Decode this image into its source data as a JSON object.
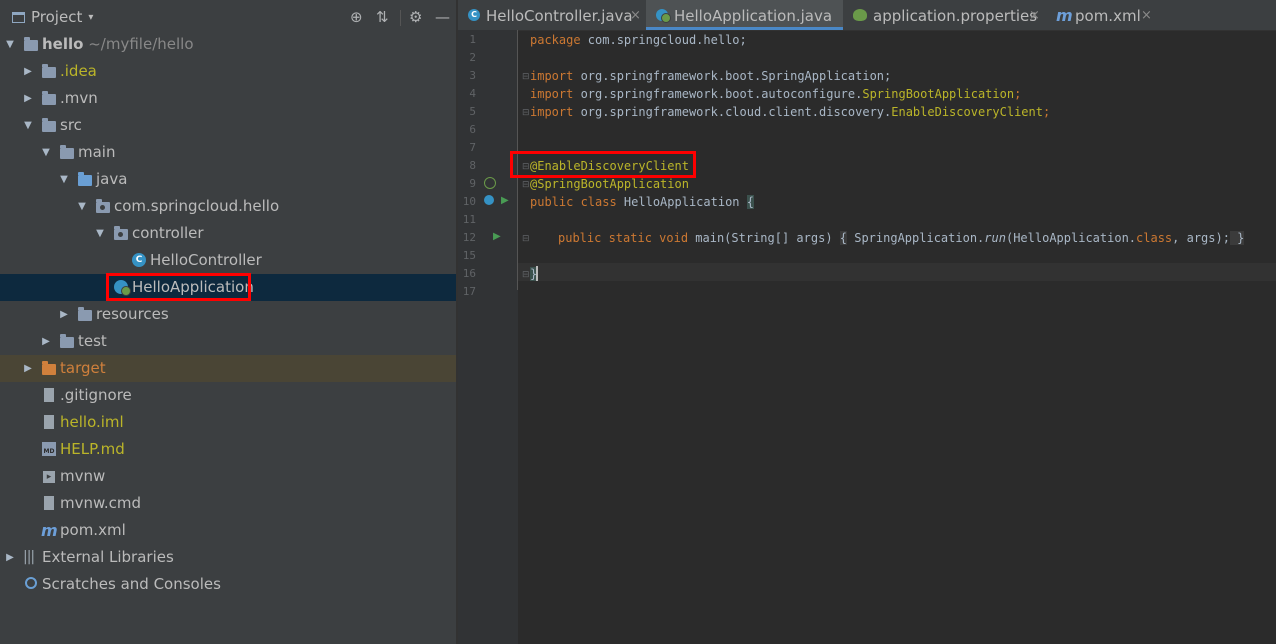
{
  "panel": {
    "title": "Project",
    "caret": "▾",
    "locate_icon": "⊕",
    "collapse_icon": "⇅",
    "settings_icon": "⚙",
    "hide_icon": "—"
  },
  "tree": {
    "hello": "hello",
    "hello_path": "~/myfile/hello",
    "idea": ".idea",
    "mvn": ".mvn",
    "src": "src",
    "main": "main",
    "java": "java",
    "package": "com.springcloud.hello",
    "controller": "controller",
    "hello_controller": "HelloController",
    "hello_application": "HelloApplication",
    "resources": "resources",
    "test": "test",
    "target": "target",
    "gitignore": ".gitignore",
    "hello_iml": "hello.iml",
    "help_md": "HELP.md",
    "mvnw": "mvnw",
    "mvnw_cmd": "mvnw.cmd",
    "pom": "pom.xml",
    "external_libraries": "External Libraries",
    "scratches": "Scratches and Consoles",
    "md_badge": "MD",
    "maven_badge": "m"
  },
  "tabs": {
    "t1": "HelloController.java",
    "t2": "HelloApplication.java",
    "t3": "application.properties",
    "t4": "pom.xml",
    "close": "×"
  },
  "lines": [
    "1",
    "2",
    "3",
    "4",
    "5",
    "6",
    "7",
    "8",
    "9",
    "10",
    "11",
    "12",
    "15",
    "16",
    "17"
  ],
  "code": {
    "l1_kw": "package",
    "l1_rest": " com.springcloud.hello;",
    "import_kw": "import",
    "l3_rest": " org.springframework.boot.SpringApplication;",
    "l4_a": " org.springframework.boot.autoconfigure.",
    "l4_b": "SpringBootApplication",
    "l4_c": ";",
    "l5_a": " org.springframework.cloud.client.discovery.",
    "l5_b": "EnableDiscoveryClient",
    "l5_c": ";",
    "l8": "@EnableDiscoveryClient",
    "l9": "@SpringBootApplication",
    "l10_kw": "public class",
    "l10_rest": " HelloApplication ",
    "l10_brace": "{",
    "l12_kw": "public static void",
    "l12_a": " main(String[] args) ",
    "l12_b": "{",
    "l12_c": " SpringApplication.",
    "l12_d": "run",
    "l12_e": "(HelloApplication.",
    "l12_f": "class",
    "l12_g": ", args);",
    "l12_h": " }",
    "l16": "}"
  },
  "colors": {
    "keyword": "#cc7832",
    "annotation": "#bbb529",
    "text": "#a9b7c6",
    "highlight": "#ff0000",
    "selection": "#0d293e"
  }
}
